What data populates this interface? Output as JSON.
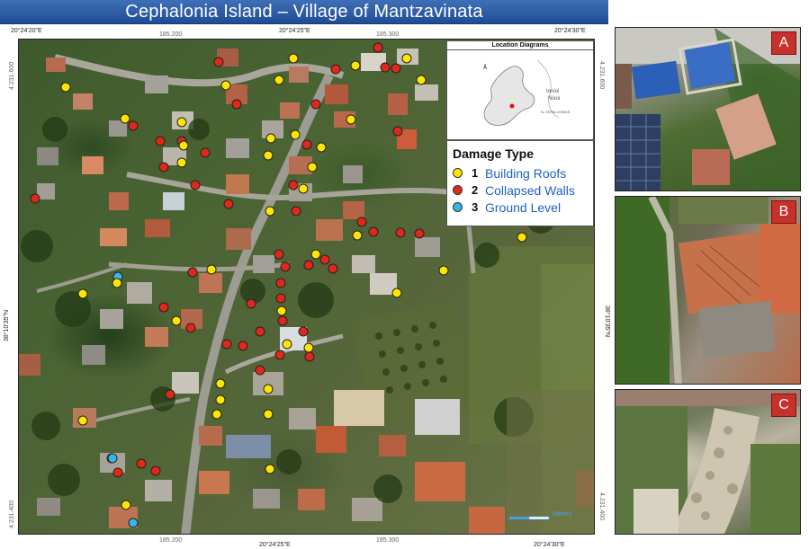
{
  "title": "Cephalonia Island – Village of Mantzavinata",
  "coordinates": {
    "top_left_lon": "20°24'20\"E",
    "top_mid_easting_1": "185.200",
    "top_mid_lon": "20°24'25\"E",
    "top_mid_easting_2": "185.300",
    "top_right_lon": "20°24'30\"E",
    "bottom_easting_1": "185.200",
    "bottom_lon_1": "20°24'25\"E",
    "bottom_easting_2": "185.300",
    "bottom_lon_2": "20°24'30\"E",
    "left_northing_top": "4.231.600",
    "left_lat": "38°10'35\"N",
    "left_northing_bottom": "4.231.400",
    "right_northing_top": "4.231.600",
    "right_lat": "38°10'35\"N",
    "right_northing_bottom": "4.231.400"
  },
  "location_diagram": {
    "title": "Location Diagrams",
    "sea_label_1": "Ionioi",
    "sea_label_2": "Nisoi",
    "region_label": "N. KEFALLONIAS"
  },
  "legend": {
    "title": "Damage Type",
    "items": [
      {
        "num": "1",
        "label": "Building Roofs",
        "color": "#ffe600"
      },
      {
        "num": "2",
        "label": "Collapsed Walls",
        "color": "#e0281a"
      },
      {
        "num": "3",
        "label": "Ground Level",
        "color": "#35b6e8"
      }
    ]
  },
  "scale_bar": {
    "label": "Meters"
  },
  "photos": [
    {
      "tag": "A"
    },
    {
      "tag": "B"
    },
    {
      "tag": "C"
    }
  ],
  "colors": {
    "title_bar": "#2a5aa8",
    "building_roofs": "#ffe600",
    "collapsed_walls": "#e0281a",
    "ground_level": "#35b6e8",
    "photo_tag": "#c8302b"
  }
}
